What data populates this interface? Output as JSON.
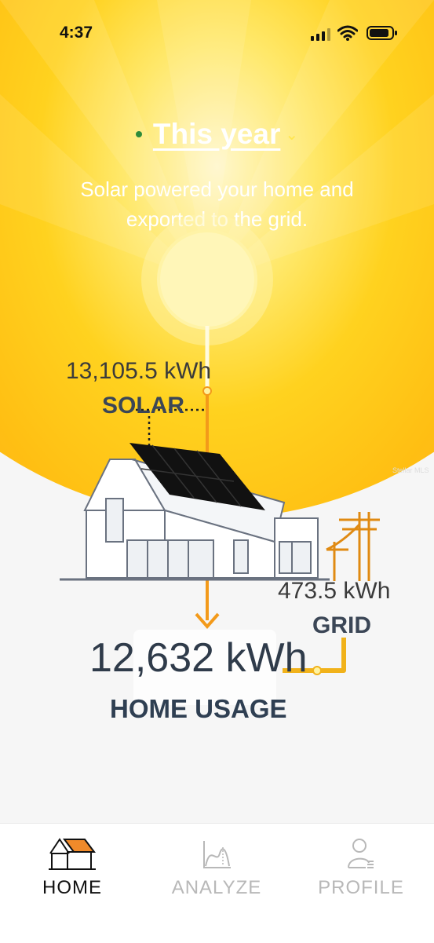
{
  "status_bar": {
    "time": "4:37"
  },
  "header": {
    "period_label": "This year",
    "subtitle_line1": "Solar powered your home and",
    "subtitle_line2": "exported to the grid."
  },
  "energy_flow": {
    "solar": {
      "value": "13,105.5 kWh",
      "label": "SOLAR"
    },
    "grid": {
      "value": "473.5 kWh",
      "label": "GRID"
    },
    "home": {
      "value": "12,632 kWh",
      "label": "HOME USAGE"
    },
    "watermark": "Stellar MLS"
  },
  "tabs": [
    {
      "label": "HOME",
      "icon": "house-icon",
      "active": true
    },
    {
      "label": "ANALYZE",
      "icon": "chart-icon",
      "active": false
    },
    {
      "label": "PROFILE",
      "icon": "profile-icon",
      "active": false
    }
  ],
  "colors": {
    "sun_orange": "#ffab1b",
    "sun_yellow": "#ffd21f",
    "flow_orange": "#f39a1a",
    "label_dark": "#3b4656"
  }
}
